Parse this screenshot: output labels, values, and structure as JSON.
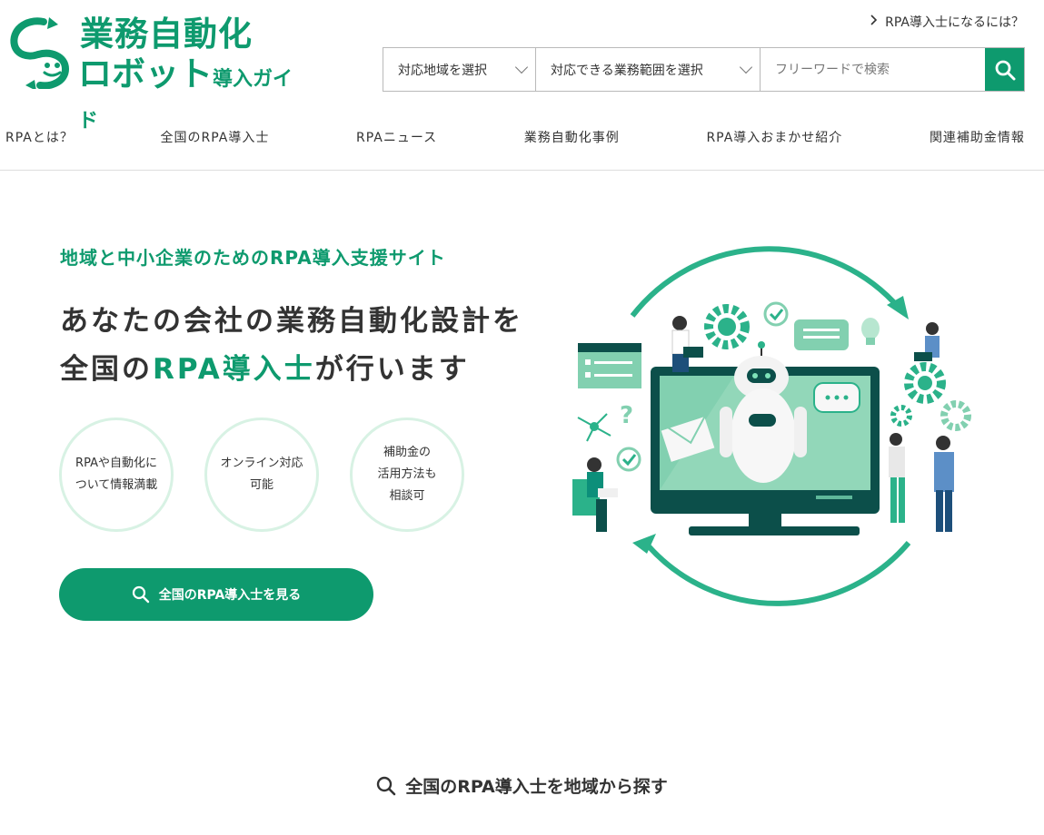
{
  "logo": {
    "line1": "業務自動化",
    "line2_main": "ロボット",
    "line2_sub": "導入ガイド"
  },
  "top_link": "RPA導入士になるには？",
  "search": {
    "region_label": "対応地域を選択",
    "scope_label": "対応できる業務範囲を選択",
    "placeholder": "フリーワードで検索"
  },
  "nav": [
    {
      "label": "RPAとは？"
    },
    {
      "label": "全国のRPA導入士"
    },
    {
      "label": "RPAニュース"
    },
    {
      "label": "業務自動化事例"
    },
    {
      "label": "RPA導入おまかせ紹介"
    },
    {
      "label": "関連補助金情報"
    }
  ],
  "hero": {
    "subtitle": "地域と中小企業のためのRPA導入支援サイト",
    "title_line1": "あなたの会社の業務自動化設計を",
    "title_line2_pre": "全国の",
    "title_line2_accent": "RPA導入士",
    "title_line2_post": "が行います",
    "bubbles": [
      {
        "line1": "RPAや自動化に",
        "line2": "ついて情報満載",
        "line3": ""
      },
      {
        "line1": "オンライン対応",
        "line2": "可能",
        "line3": ""
      },
      {
        "line1": "補助金の",
        "line2": "活用方法も",
        "line3": "相談可"
      }
    ],
    "cta_label": "全国のRPA導入士を見る"
  },
  "section": {
    "heading": "全国のRPA導入士を地域から探す"
  },
  "colors": {
    "brand": "#0e9a6e",
    "bubble_border": "#d8f2e4",
    "text": "#333333"
  }
}
